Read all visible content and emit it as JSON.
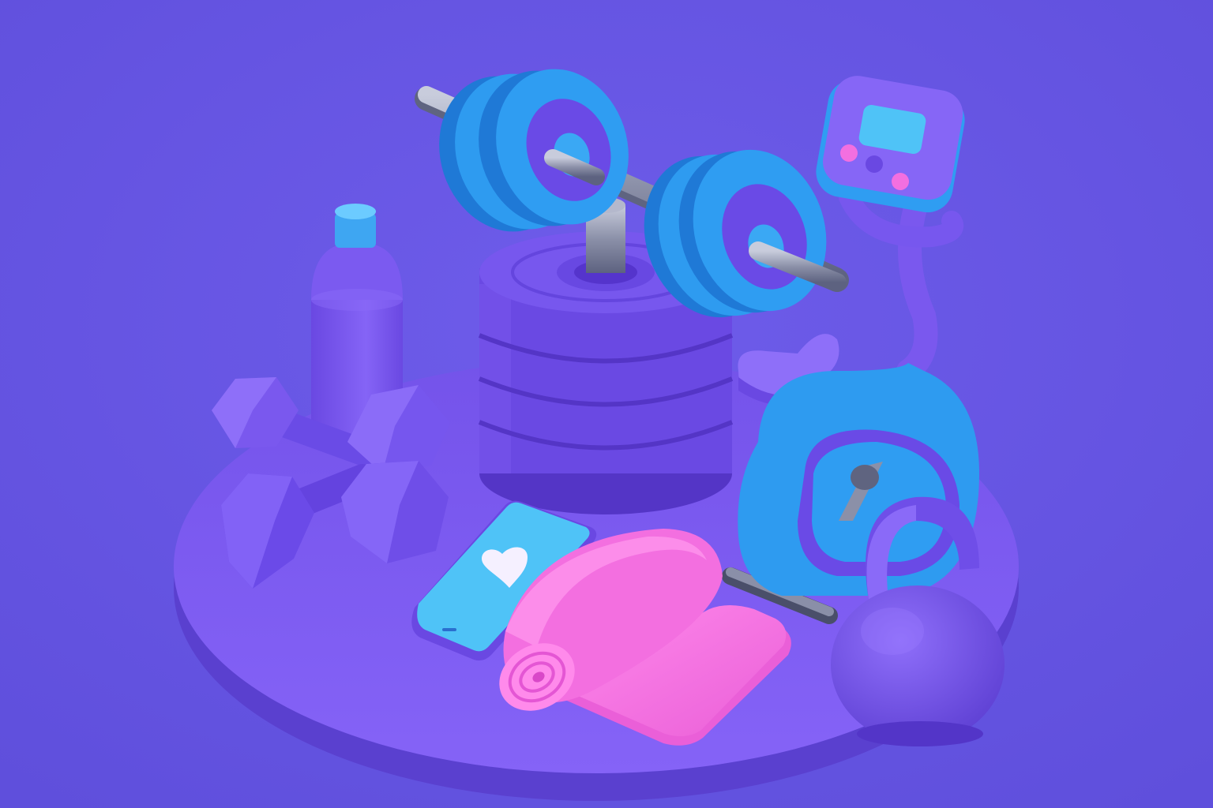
{
  "scene": {
    "objects": [
      "platform",
      "barbell",
      "weight-plate-stack",
      "water-bottle",
      "dumbbell-pair",
      "exercise-bike",
      "smartphone",
      "yoga-mat",
      "kettlebell"
    ]
  },
  "colors": {
    "background": "#6a55e6",
    "platform_top": "#7e5cf2",
    "platform_side": "#5f44d6",
    "violet": "#7a58ee",
    "violet_dark": "#5c3fd0",
    "violet_light": "#9274fb",
    "blue": "#2e9bf0",
    "blue_light": "#58c0f8",
    "blue_dark": "#1f79d6",
    "cyan_screen": "#4fc3f7",
    "pink": "#f36fe0",
    "pink_light": "#ff90ec",
    "metal": "#9aa0b8",
    "metal_dark": "#5f6480",
    "heart": "#f5f0ff"
  },
  "icons": {
    "phone_screen_icon": "heart-icon",
    "bike_display_buttons": "pink-button-icons"
  }
}
